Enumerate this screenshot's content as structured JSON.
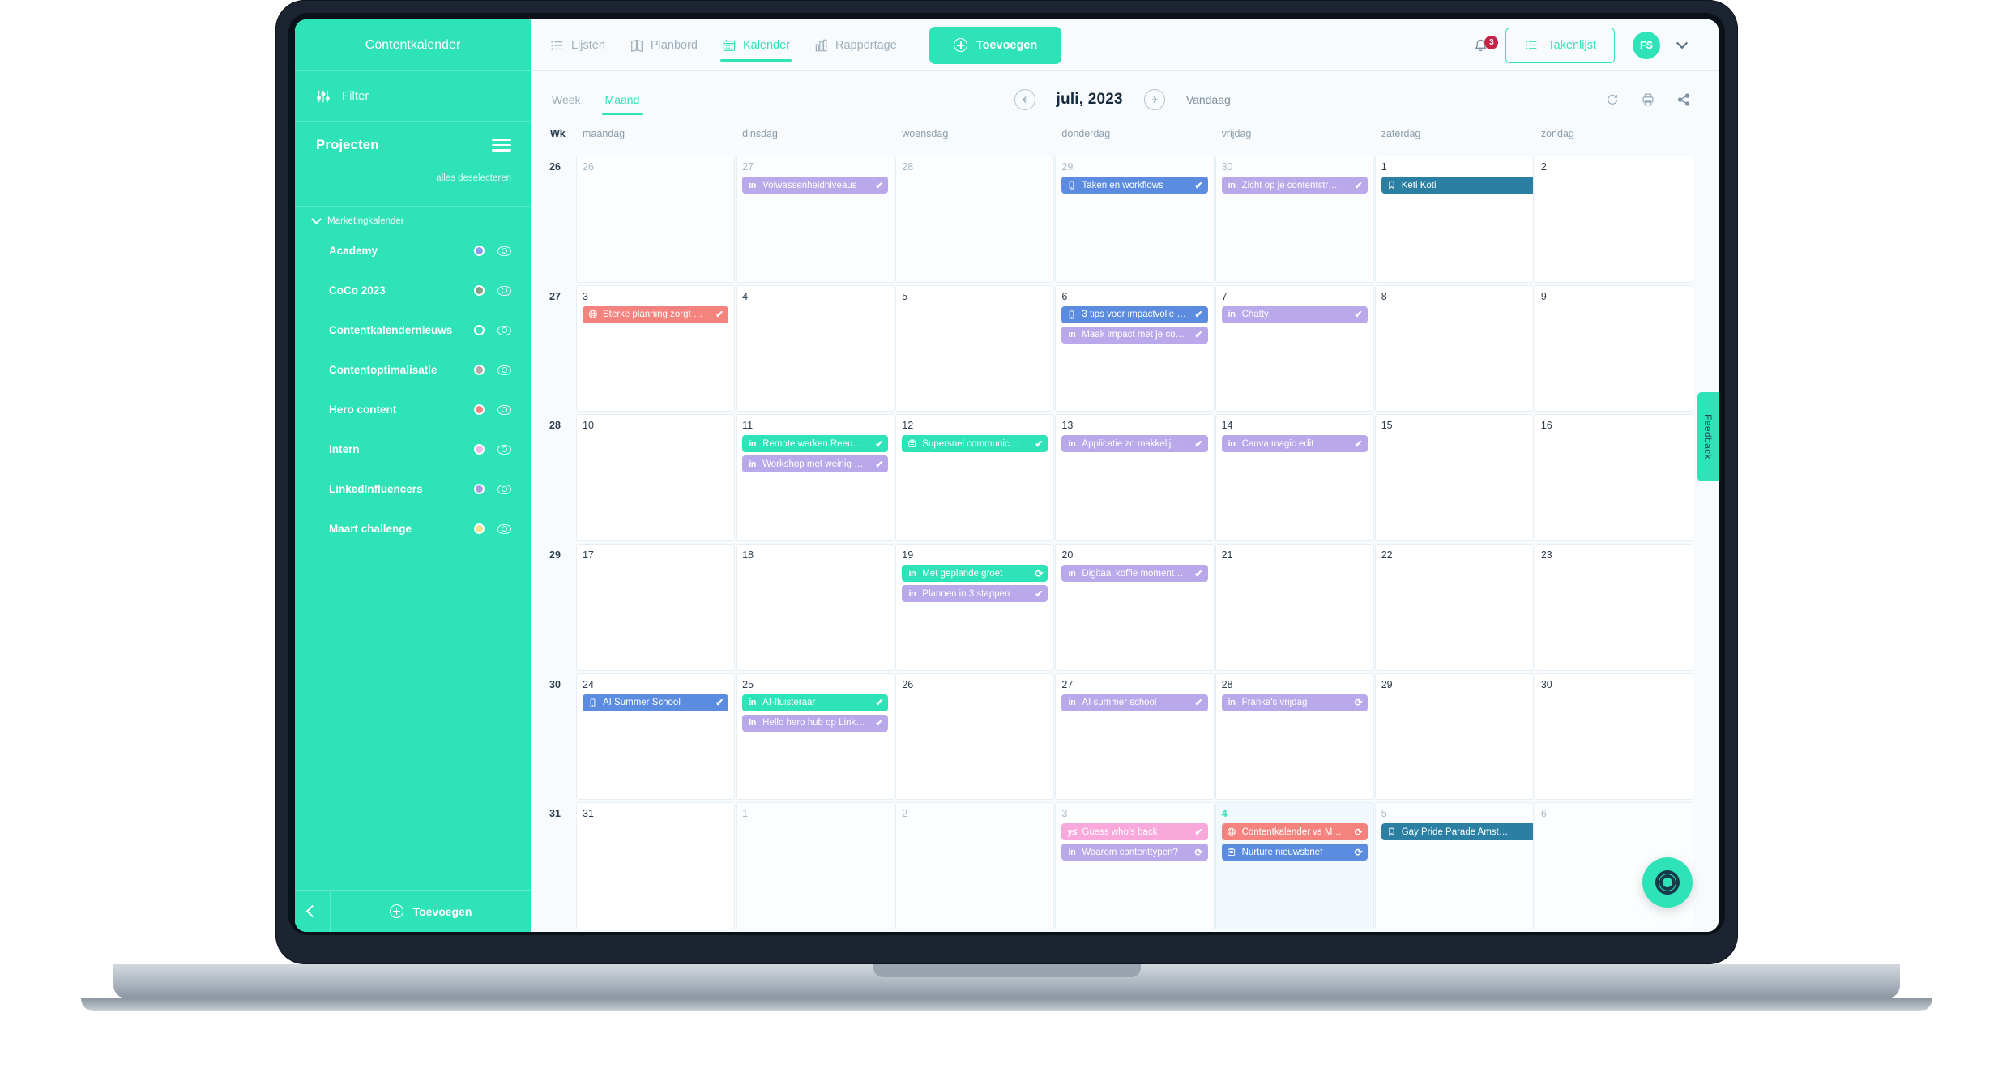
{
  "sidebar": {
    "title": "Contentkalender",
    "filter_label": "Filter",
    "projects_label": "Projecten",
    "deselect_label": "alles deselecteren",
    "group_label": "Marketingkalender",
    "items": [
      {
        "label": "Academy",
        "color": "#8a9cf0"
      },
      {
        "label": "CoCo 2023",
        "color": "#7fa184"
      },
      {
        "label": "Contentkalendernieuws",
        "color": "#2fe3b8"
      },
      {
        "label": "Contentoptimalisatie",
        "color": "#b6aaa6"
      },
      {
        "label": "Hero content",
        "color": "#f4827d"
      },
      {
        "label": "Intern",
        "color": "#f4b8e8"
      },
      {
        "label": "LinkedInfluencers",
        "color": "#a99ce0"
      },
      {
        "label": "Maart challenge",
        "color": "#fadf8e"
      }
    ],
    "footer_add_label": "Toevoegen"
  },
  "topbar": {
    "tabs": [
      {
        "label": "Lijsten",
        "icon": "list-icon",
        "active": false
      },
      {
        "label": "Planbord",
        "icon": "board-icon",
        "active": false
      },
      {
        "label": "Kalender",
        "icon": "calendar-icon",
        "active": true
      },
      {
        "label": "Rapportage",
        "icon": "chart-icon",
        "active": false
      }
    ],
    "add_label": "Toevoegen",
    "notification_count": "3",
    "tasks_label": "Takenlijst",
    "avatar_initials": "FS"
  },
  "toolbar": {
    "view_tabs": [
      {
        "label": "Week",
        "active": false
      },
      {
        "label": "Maand",
        "active": true
      }
    ],
    "month_label": "juli, 2023",
    "today_label": "Vandaag",
    "icons": [
      "refresh-icon",
      "print-icon",
      "share-icon"
    ]
  },
  "calendar": {
    "week_header": "Wk",
    "day_names": [
      "maandag",
      "dinsdag",
      "woensdag",
      "donderdag",
      "vrijdag",
      "zaterdag",
      "zondag"
    ],
    "weeks": [
      {
        "week": "26",
        "days": [
          {
            "num": "26",
            "muted": true,
            "events": []
          },
          {
            "num": "27",
            "muted": true,
            "events": [
              {
                "title": "Volwassenheidniveaus",
                "icon": "linkedin-icon",
                "color": "#b9a8ea",
                "status": "check"
              }
            ]
          },
          {
            "num": "28",
            "muted": true,
            "events": []
          },
          {
            "num": "29",
            "muted": true,
            "events": [
              {
                "title": "Taken en workflows",
                "icon": "mobile-icon",
                "color": "#5b8ce0",
                "status": "check"
              }
            ]
          },
          {
            "num": "30",
            "muted": true,
            "events": [
              {
                "title": "Zicht op je contentstr…",
                "icon": "linkedin-icon",
                "color": "#b9a8ea",
                "status": "check"
              }
            ]
          },
          {
            "num": "1",
            "muted": false,
            "events": [
              {
                "title": "Keti Koti",
                "icon": "bookmark-icon",
                "color": "#2a7fa3",
                "status": "",
                "wide": true
              }
            ]
          },
          {
            "num": "2",
            "muted": false,
            "events": []
          }
        ]
      },
      {
        "week": "27",
        "days": [
          {
            "num": "3",
            "muted": false,
            "events": [
              {
                "title": "Sterke planning zorgt …",
                "icon": "globe-icon",
                "color": "#f4827d",
                "status": "check"
              }
            ]
          },
          {
            "num": "4",
            "muted": false,
            "events": []
          },
          {
            "num": "5",
            "muted": false,
            "events": []
          },
          {
            "num": "6",
            "muted": false,
            "events": [
              {
                "title": "3 tips voor impactvolle …",
                "icon": "mobile-icon",
                "color": "#5b8ce0",
                "status": "check"
              },
              {
                "title": "Maak impact met je co…",
                "icon": "linkedin-icon",
                "color": "#b9a8ea",
                "status": "check"
              }
            ]
          },
          {
            "num": "7",
            "muted": false,
            "events": [
              {
                "title": "Chatty",
                "icon": "linkedin-icon",
                "color": "#b9a8ea",
                "status": "check"
              }
            ]
          },
          {
            "num": "8",
            "muted": false,
            "events": []
          },
          {
            "num": "9",
            "muted": false,
            "events": []
          }
        ]
      },
      {
        "week": "28",
        "days": [
          {
            "num": "10",
            "muted": false,
            "events": []
          },
          {
            "num": "11",
            "muted": false,
            "events": [
              {
                "title": "Remote werken Reeu…",
                "icon": "linkedin-icon",
                "color": "#2fe3b8",
                "status": "check"
              },
              {
                "title": "Workshop met weinig …",
                "icon": "linkedin-icon",
                "color": "#b9a8ea",
                "status": "check"
              }
            ]
          },
          {
            "num": "12",
            "muted": false,
            "events": [
              {
                "title": "Supersnel communic…",
                "icon": "newsletter-icon",
                "color": "#2fe3b8",
                "status": "check"
              }
            ]
          },
          {
            "num": "13",
            "muted": false,
            "events": [
              {
                "title": "Applicatie zo makkelij…",
                "icon": "linkedin-icon",
                "color": "#b9a8ea",
                "status": "check"
              }
            ]
          },
          {
            "num": "14",
            "muted": false,
            "events": [
              {
                "title": "Canva magic edit",
                "icon": "linkedin-icon",
                "color": "#b9a8ea",
                "status": "check"
              }
            ]
          },
          {
            "num": "15",
            "muted": false,
            "events": []
          },
          {
            "num": "16",
            "muted": false,
            "events": []
          }
        ]
      },
      {
        "week": "29",
        "days": [
          {
            "num": "17",
            "muted": false,
            "events": []
          },
          {
            "num": "18",
            "muted": false,
            "events": []
          },
          {
            "num": "19",
            "muted": false,
            "events": [
              {
                "title": "Met geplande groet",
                "icon": "linkedin-icon",
                "color": "#2fe3b8",
                "status": "repeat"
              },
              {
                "title": "Plannen in 3 stappen",
                "icon": "linkedin-icon",
                "color": "#b9a8ea",
                "status": "check"
              }
            ]
          },
          {
            "num": "20",
            "muted": false,
            "events": [
              {
                "title": "Digitaal koffie moment…",
                "icon": "linkedin-icon",
                "color": "#b9a8ea",
                "status": "check"
              }
            ]
          },
          {
            "num": "21",
            "muted": false,
            "events": []
          },
          {
            "num": "22",
            "muted": false,
            "events": []
          },
          {
            "num": "23",
            "muted": false,
            "events": []
          }
        ]
      },
      {
        "week": "30",
        "days": [
          {
            "num": "24",
            "muted": false,
            "events": [
              {
                "title": "AI Summer School",
                "icon": "mobile-icon",
                "color": "#5b8ce0",
                "status": "check"
              }
            ]
          },
          {
            "num": "25",
            "muted": false,
            "events": [
              {
                "title": "AI-fluisteraar",
                "icon": "linkedin-icon",
                "color": "#2fe3b8",
                "status": "check"
              },
              {
                "title": "Hello hero hub op Link…",
                "icon": "linkedin-icon",
                "color": "#b9a8ea",
                "status": "check"
              }
            ]
          },
          {
            "num": "26",
            "muted": false,
            "events": []
          },
          {
            "num": "27",
            "muted": false,
            "events": [
              {
                "title": "AI summer school",
                "icon": "linkedin-icon",
                "color": "#b9a8ea",
                "status": "check"
              }
            ]
          },
          {
            "num": "28",
            "muted": false,
            "events": [
              {
                "title": "Franka's vrijdag",
                "icon": "linkedin-icon",
                "color": "#b9a8ea",
                "status": "repeat"
              }
            ]
          },
          {
            "num": "29",
            "muted": false,
            "events": []
          },
          {
            "num": "30",
            "muted": false,
            "events": []
          }
        ]
      },
      {
        "week": "31",
        "days": [
          {
            "num": "31",
            "muted": false,
            "events": []
          },
          {
            "num": "1",
            "muted": true,
            "events": []
          },
          {
            "num": "2",
            "muted": true,
            "events": []
          },
          {
            "num": "3",
            "muted": true,
            "events": [
              {
                "title": "Guess who's back",
                "icon": "youtube-icon",
                "color": "#f9a8dc",
                "status": "check"
              },
              {
                "title": "Waarom contenttypen?",
                "icon": "linkedin-icon",
                "color": "#b9a8ea",
                "status": "repeat"
              }
            ]
          },
          {
            "num": "4",
            "muted": false,
            "today": true,
            "events": [
              {
                "title": "Contentkalender vs M…",
                "icon": "globe-icon",
                "color": "#f4827d",
                "status": "repeat"
              },
              {
                "title": "Nurture nieuwsbrief",
                "icon": "newsletter-icon",
                "color": "#5b8ce0",
                "status": "repeat"
              }
            ]
          },
          {
            "num": "5",
            "muted": true,
            "events": [
              {
                "title": "Gay Pride Parade Amst…",
                "icon": "bookmark-icon",
                "color": "#2a7fa3",
                "status": "",
                "wide": true
              }
            ]
          },
          {
            "num": "6",
            "muted": true,
            "events": []
          }
        ]
      }
    ]
  },
  "feedback": {
    "label": "Feedback"
  },
  "help": {
    "icon": "lifebuoy-icon"
  }
}
